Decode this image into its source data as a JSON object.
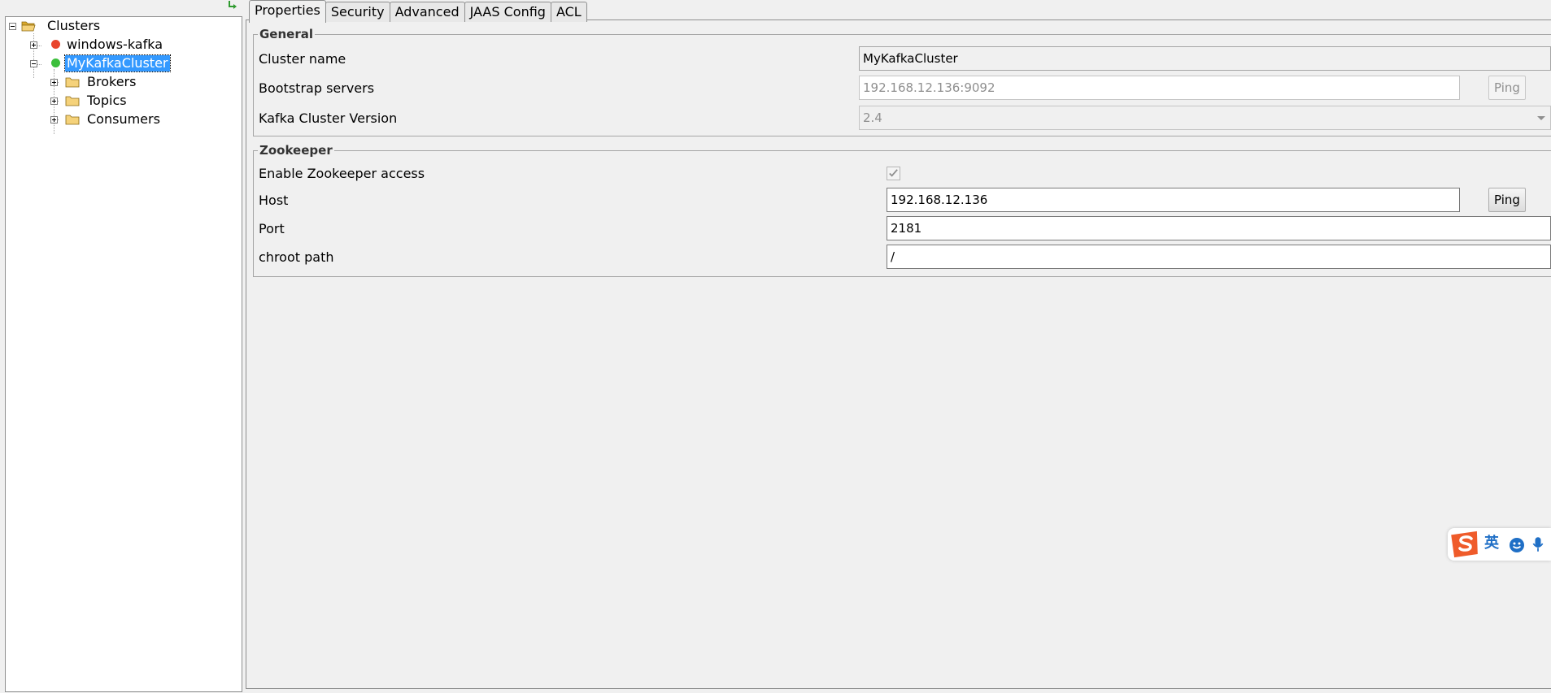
{
  "tabs": [
    {
      "label": "Properties",
      "active": true
    },
    {
      "label": "Security",
      "active": false
    },
    {
      "label": "Advanced",
      "active": false
    },
    {
      "label": "JAAS Config",
      "active": false
    },
    {
      "label": "ACL",
      "active": false
    }
  ],
  "tree": {
    "root": "Clusters",
    "clusters": [
      {
        "label": "windows-kafka",
        "status_color": "#e8452c"
      },
      {
        "label": "MyKafkaCluster",
        "status_color": "#3cbf3c",
        "selected": true
      }
    ],
    "children": [
      "Brokers",
      "Topics",
      "Consumers"
    ]
  },
  "general": {
    "title": "General",
    "cluster_name_label": "Cluster name",
    "cluster_name_value": "MyKafkaCluster",
    "bootstrap_label": "Bootstrap servers",
    "bootstrap_value": "192.168.12.136:9092",
    "ping_label": "Ping",
    "version_label": "Kafka Cluster Version",
    "version_value": "2.4"
  },
  "zookeeper": {
    "title": "Zookeeper",
    "enable_label": "Enable Zookeeper access",
    "enabled": true,
    "host_label": "Host",
    "host_value": "192.168.12.136",
    "ping_label": "Ping",
    "port_label": "Port",
    "port_value": "2181",
    "chroot_label": "chroot path",
    "chroot_value": "/"
  },
  "ime": {
    "lang_label": "英"
  },
  "colors": {
    "selection": "#3399ff",
    "ime_brand": "#ef5b2a",
    "ime_icon": "#1f6fc6"
  }
}
